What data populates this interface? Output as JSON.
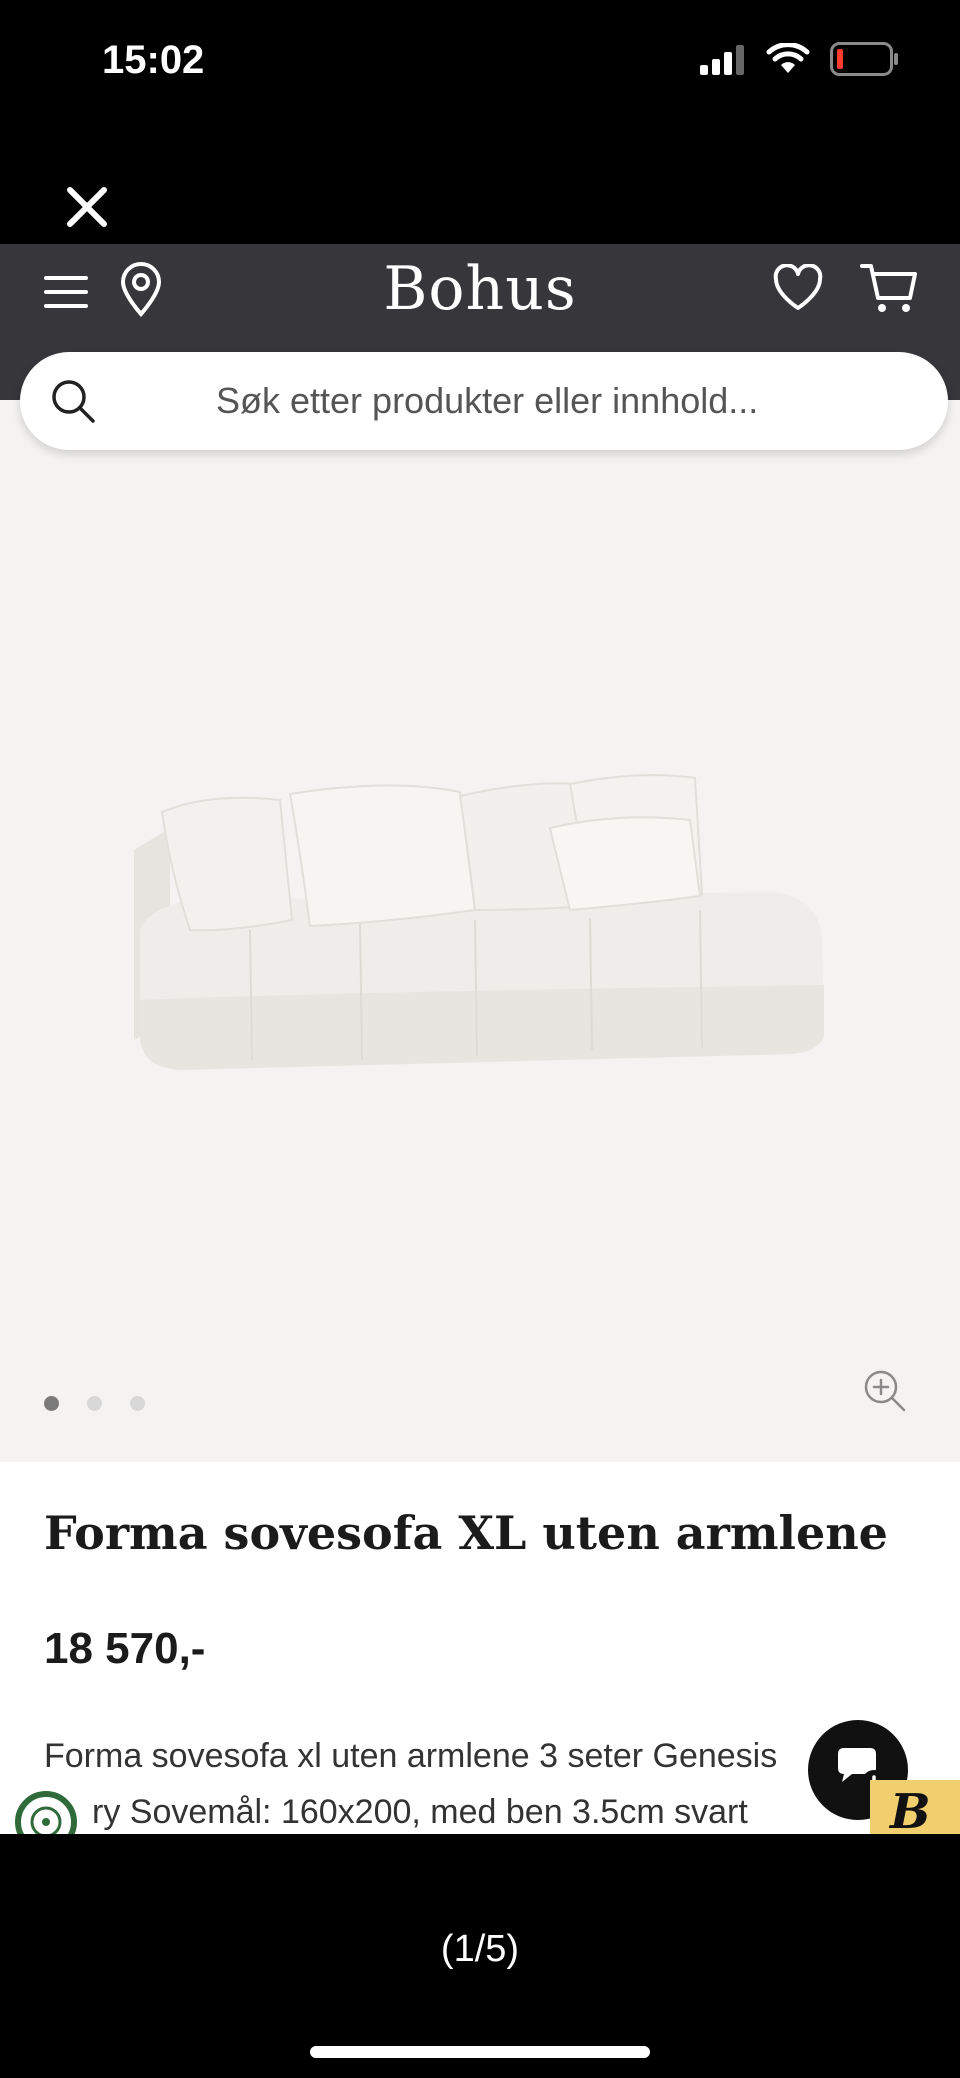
{
  "status": {
    "time": "15:02"
  },
  "header": {
    "logo": "Bohus"
  },
  "search": {
    "placeholder": "Søk etter produkter eller innhold..."
  },
  "gallery": {
    "image_count": 3,
    "active_index": 0
  },
  "product": {
    "title": "Forma sovesofa XL uten armlene",
    "price": "18 570,-",
    "description_line1": "Forma sovesofa xl uten armlene 3 seter Genesis",
    "description_line2": "ry Sovemål: 160x200, med ben 3.5cm svart"
  },
  "viewer": {
    "counter": "(1/5)"
  },
  "colors": {
    "header_bg": "#37363b",
    "gallery_bg": "#f4f3f2",
    "badge_yellow": "#f2cf6e"
  }
}
